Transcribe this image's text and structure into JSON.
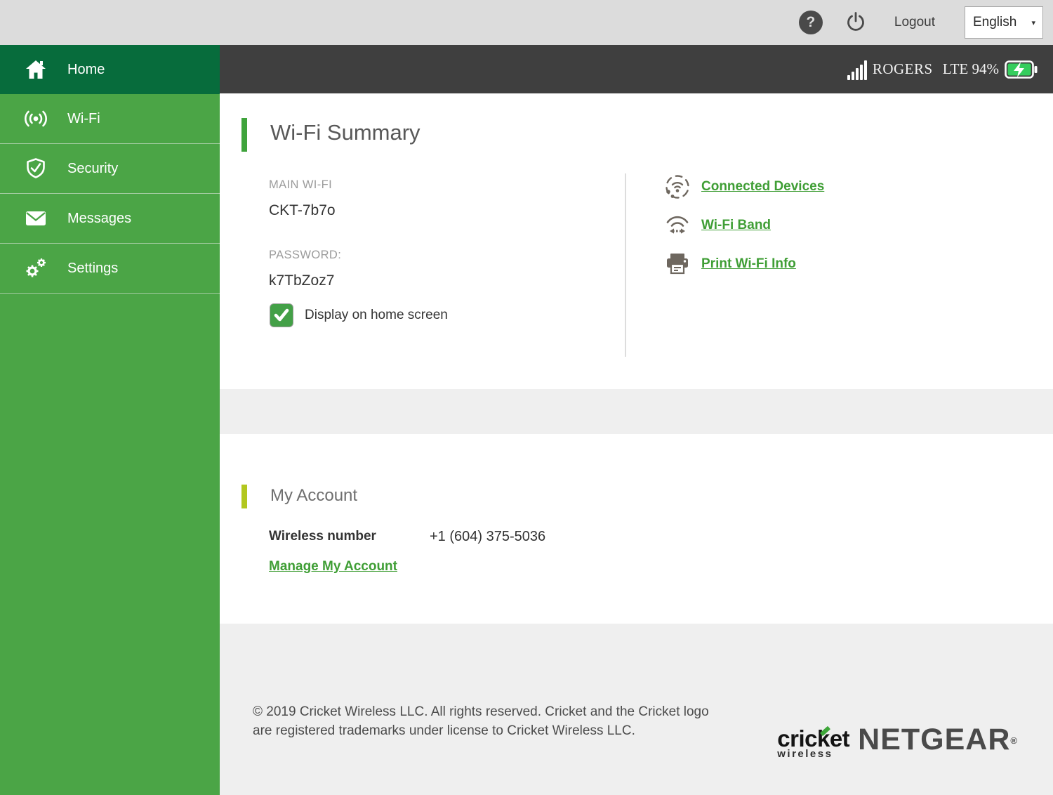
{
  "topbar": {
    "logout_label": "Logout",
    "language_selected": "English"
  },
  "icons": {
    "help_glyph": "?",
    "dropdown_arrow": "▾"
  },
  "status_bar": {
    "carrier": "ROGERS",
    "network_and_battery": "LTE 94%",
    "battery_percent": "94%",
    "battery_color": "#35cd5d"
  },
  "sidebar": {
    "items": [
      {
        "label": "Home",
        "icon": "home-icon",
        "active": true
      },
      {
        "label": "Wi-Fi",
        "icon": "wifi-icon",
        "active": false
      },
      {
        "label": "Security",
        "icon": "shield-icon",
        "active": false
      },
      {
        "label": "Messages",
        "icon": "envelope-icon",
        "active": false
      },
      {
        "label": "Settings",
        "icon": "gears-icon",
        "active": false
      }
    ],
    "bg_color": "#4ba546",
    "active_color": "#076c3c"
  },
  "wifi_summary": {
    "title": "Wi-Fi Summary",
    "main_wifi_label": "MAIN WI-FI",
    "main_wifi_value": "CKT-7b7o",
    "password_label": "PASSWORD:",
    "password_value": "k7TbZoz7",
    "display_checkbox_label": "Display on home screen",
    "display_checkbox_checked": true,
    "links": [
      {
        "label": "Connected Devices",
        "icon": "connected-devices-icon"
      },
      {
        "label": "Wi-Fi Band",
        "icon": "wifi-band-icon"
      },
      {
        "label": "Print Wi-Fi Info",
        "icon": "printer-icon"
      }
    ],
    "accent_color": "#3fa33c",
    "link_color": "#3f9e35"
  },
  "my_account": {
    "title": "My Account",
    "wireless_number_label": "Wireless number",
    "wireless_number_value": "+1 (604) 375-5036",
    "manage_link_label": "Manage My Account",
    "accent_color": "#b2c71f"
  },
  "footer": {
    "copyright_line1": "© 2019 Cricket Wireless LLC. All rights reserved. Cricket and the Cricket logo",
    "copyright_line2": "are registered trademarks under license to Cricket Wireless LLC.",
    "cricket_logo_word": "cricket",
    "cricket_logo_sub": "wireless",
    "netgear_logo_word": "NETGEAR",
    "netgear_reg_mark": "®"
  }
}
